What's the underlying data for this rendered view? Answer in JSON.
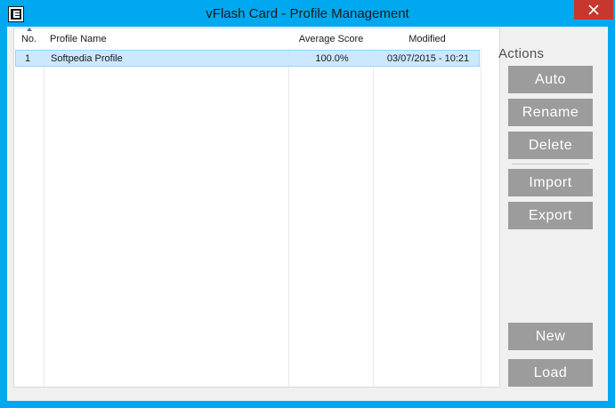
{
  "window": {
    "title": "vFlash Card - Profile Management"
  },
  "list": {
    "columns": {
      "no": "No.",
      "profile_name": "Profile Name",
      "average_score": "Average Score",
      "modified": "Modified"
    },
    "rows": [
      {
        "no": "1",
        "profile_name": "Softpedia Profile",
        "average_score": "100.0%",
        "modified": "03/07/2015 - 10:21"
      }
    ]
  },
  "actions": {
    "label": "Actions",
    "auto": "Auto",
    "rename": "Rename",
    "delete": "Delete",
    "import": "Import",
    "export": "Export",
    "new": "New",
    "load": "Load"
  },
  "colors": {
    "titlebar": "#00a8f0",
    "close": "#c7372d",
    "selection": "#cce8ff",
    "button": "#9c9c9c"
  },
  "icons": [
    "app-icon",
    "close-icon",
    "sort-ascending-icon"
  ]
}
